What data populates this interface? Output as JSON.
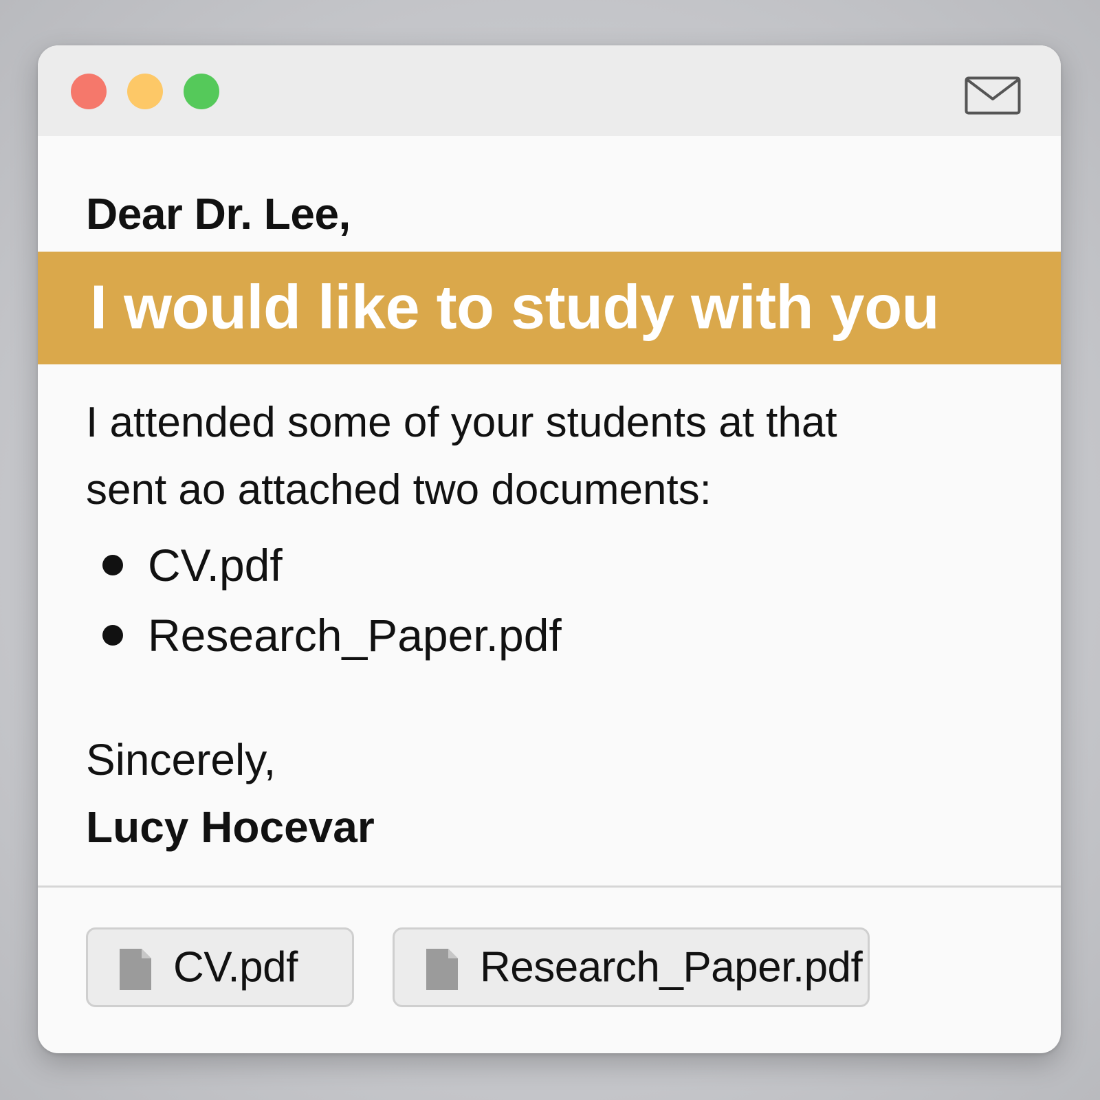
{
  "window": {
    "buttons": [
      "close",
      "minimize",
      "zoom"
    ],
    "title_icon": "mail-icon"
  },
  "email": {
    "salutation": "Dear Dr. Lee,",
    "banner": "I would like to study with you",
    "body_line1": "I attended some of your students at that",
    "body_line2": "sent ao attached two documents:",
    "list_items": [
      "CV.pdf",
      "Research_Paper.pdf"
    ],
    "closing": "Sincerely,",
    "signature": "Lucy Hocevar"
  },
  "attachments": [
    {
      "name": "CV.pdf",
      "icon": "file-icon"
    },
    {
      "name": "Research_Paper.pdf",
      "icon": "file-icon"
    }
  ],
  "colors": {
    "banner": "#daa84b",
    "close": "#f5786b",
    "minimize": "#fdc867",
    "zoom": "#55c95a"
  }
}
